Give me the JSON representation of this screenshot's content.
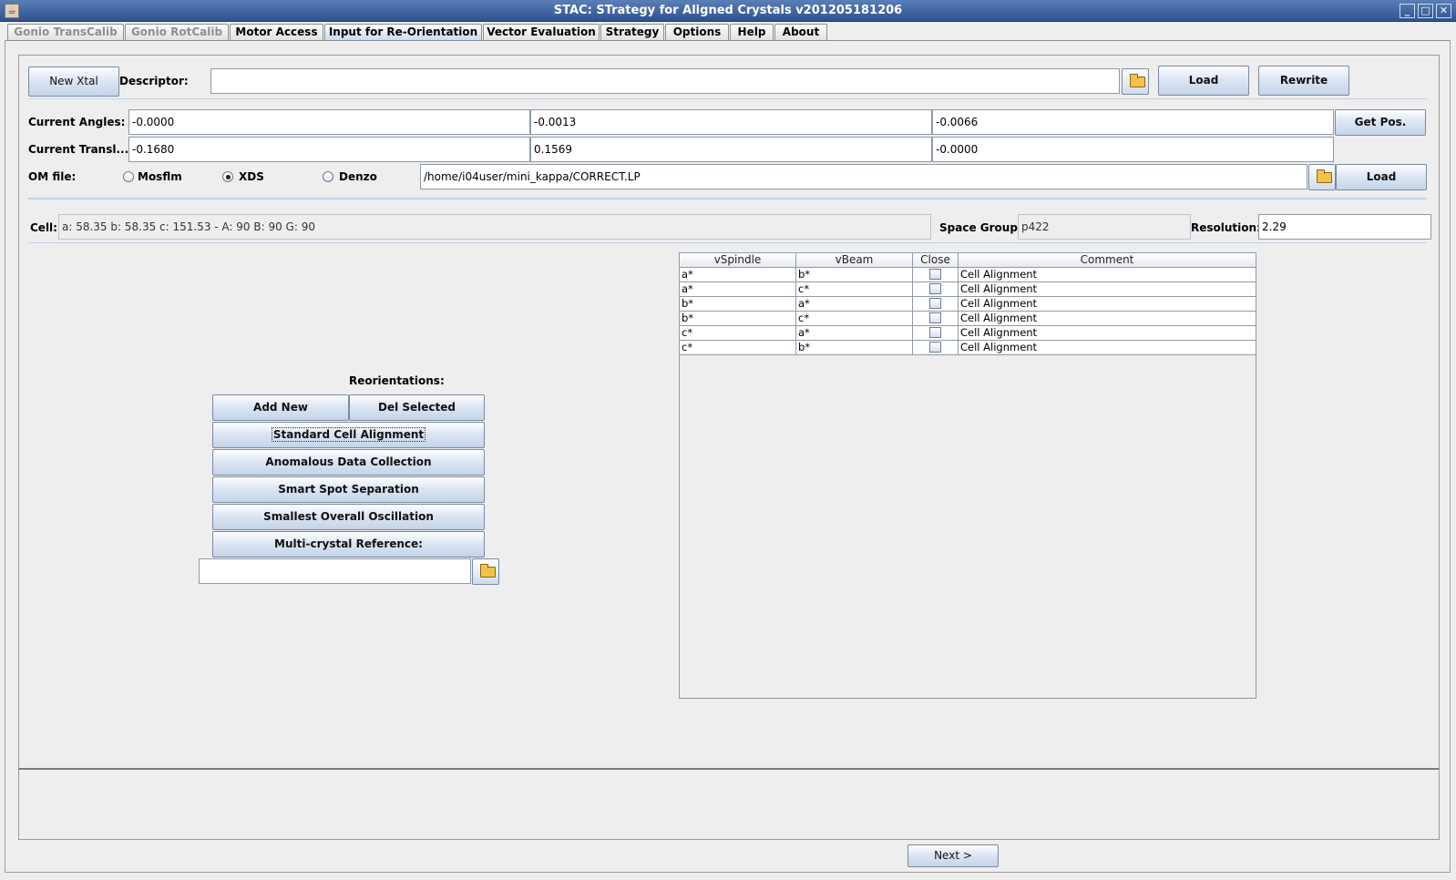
{
  "window": {
    "title": "STAC: STrategy for Aligned Crystals v201205181206"
  },
  "tabs": [
    {
      "label": "Gonio TransCalib",
      "state": "disabled"
    },
    {
      "label": "Gonio RotCalib",
      "state": "disabled"
    },
    {
      "label": "Motor Access",
      "state": "normal"
    },
    {
      "label": "Input for Re-Orientation",
      "state": "active"
    },
    {
      "label": "Vector Evaluation",
      "state": "normal"
    },
    {
      "label": "Strategy",
      "state": "normal"
    },
    {
      "label": "Options",
      "state": "normal"
    },
    {
      "label": "Help",
      "state": "normal"
    },
    {
      "label": "About",
      "state": "normal"
    }
  ],
  "crystal": {
    "new_xtal_label": "New Xtal",
    "descriptor_label": "Descriptor:",
    "descriptor_value": "",
    "load_label": "Load",
    "rewrite_label": "Rewrite"
  },
  "angles": {
    "label": "Current Angles:",
    "values": [
      "-0.0000",
      "-0.0013",
      "-0.0066"
    ],
    "get_pos_label": "Get Pos."
  },
  "transl": {
    "label": "Current Transl...",
    "values": [
      "-0.1680",
      "0.1569",
      "-0.0000"
    ]
  },
  "om_file": {
    "label": "OM file:",
    "options": [
      {
        "label": "Mosflm",
        "checked": false
      },
      {
        "label": "XDS",
        "checked": true
      },
      {
        "label": "Denzo",
        "checked": false
      }
    ],
    "path": "/home/i04user/mini_kappa/CORRECT.LP",
    "load_label": "Load"
  },
  "cell": {
    "label": "Cell:",
    "value": "a: 58.35  b: 58.35  c: 151.53  -  A: 90  B: 90  G: 90",
    "space_group_label": "Space Group:",
    "space_group": "p422",
    "resolution_label": "Resolution:",
    "resolution": "2.29"
  },
  "reorientations": {
    "title": "Reorientations:",
    "add_new": "Add New",
    "del_selected": "Del Selected",
    "buttons": [
      "Standard Cell Alignment",
      "Anomalous Data Collection",
      "Smart Spot Separation",
      "Smallest Overall Oscillation",
      "Multi-crystal Reference:"
    ],
    "reference_value": ""
  },
  "table": {
    "columns": [
      "vSpindle",
      "vBeam",
      "Close",
      "Comment"
    ],
    "rows": [
      {
        "vspindle": "a*",
        "vbeam": "b*",
        "close": false,
        "comment": "Cell Alignment"
      },
      {
        "vspindle": "a*",
        "vbeam": "c*",
        "close": false,
        "comment": "Cell Alignment"
      },
      {
        "vspindle": "b*",
        "vbeam": "a*",
        "close": false,
        "comment": "Cell Alignment"
      },
      {
        "vspindle": "b*",
        "vbeam": "c*",
        "close": false,
        "comment": "Cell Alignment"
      },
      {
        "vspindle": "c*",
        "vbeam": "a*",
        "close": false,
        "comment": "Cell Alignment"
      },
      {
        "vspindle": "c*",
        "vbeam": "b*",
        "close": false,
        "comment": "Cell Alignment"
      }
    ]
  },
  "footer": {
    "next_label": "Next >"
  },
  "colors": {
    "titlebar": "#3f64a0",
    "button_face": "#dce6f4",
    "active_tab": "#c8daf0",
    "background": "#eeeeee"
  },
  "icons": {
    "app": "java-cup-icon",
    "folder": "folder-icon"
  }
}
